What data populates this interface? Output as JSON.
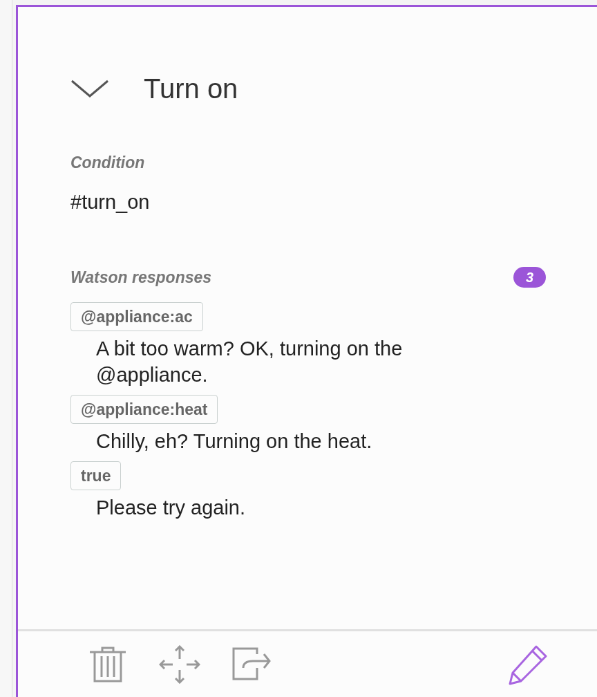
{
  "node": {
    "title": "Turn on",
    "expanded": true,
    "condition": {
      "label": "Condition",
      "value": "#turn_on"
    },
    "responses": {
      "label": "Watson responses",
      "count": "3",
      "items": [
        {
          "condition": "@appliance:ac",
          "text": "A bit too warm? OK, turning on the @appliance."
        },
        {
          "condition": "@appliance:heat",
          "text": "Chilly, eh? Turning on the heat."
        },
        {
          "condition": "true",
          "text": "Please try again."
        }
      ]
    }
  }
}
